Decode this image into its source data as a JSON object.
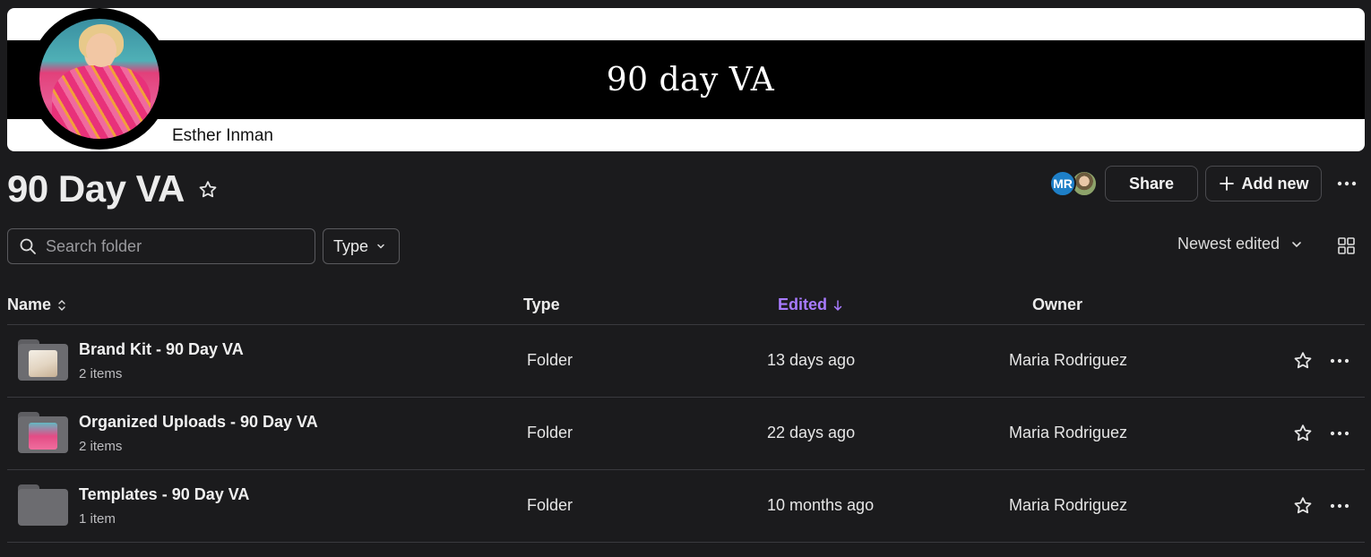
{
  "banner": {
    "title": "90 day VA",
    "name": "Esther Inman"
  },
  "header": {
    "title": "90 Day VA",
    "collaborator_initials": "MR",
    "share_label": "Share",
    "add_new_label": "Add new"
  },
  "toolbar": {
    "search_placeholder": "Search folder",
    "type_filter_label": "Type",
    "sort_label": "Newest edited"
  },
  "table": {
    "columns": {
      "name": "Name",
      "type": "Type",
      "edited": "Edited",
      "owner": "Owner"
    },
    "rows": [
      {
        "name": "Brand Kit - 90 Day VA",
        "count": "2 items",
        "type": "Folder",
        "edited": "13 days ago",
        "owner": "Maria Rodriguez"
      },
      {
        "name": "Organized Uploads - 90 Day VA",
        "count": "2 items",
        "type": "Folder",
        "edited": "22 days ago",
        "owner": "Maria Rodriguez"
      },
      {
        "name": "Templates - 90 Day VA",
        "count": "1 item",
        "type": "Folder",
        "edited": "10 months ago",
        "owner": "Maria Rodriguez"
      }
    ]
  },
  "colors": {
    "background": "#1b1b1d",
    "accent": "#a87bff",
    "avatar_blue": "#1e7fc7"
  },
  "icons": [
    "star-icon",
    "plus-icon",
    "more-icon",
    "search-icon",
    "chevron-down-icon",
    "sort-updown-icon",
    "arrow-down-icon",
    "grid-view-icon",
    "folder-icon"
  ]
}
